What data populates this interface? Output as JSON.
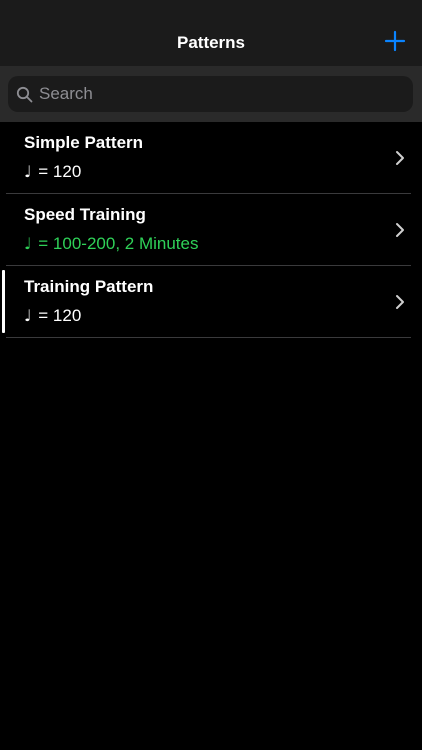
{
  "navbar": {
    "title": "Patterns",
    "add_label": "+"
  },
  "search": {
    "placeholder": "Search",
    "value": ""
  },
  "colors": {
    "accent": "#0a84ff",
    "tempo_active": "#2fd158"
  },
  "patterns": [
    {
      "name": "Simple Pattern",
      "note": "♩",
      "tempo": "= 120",
      "highlight": false,
      "selected": false
    },
    {
      "name": "Speed Training",
      "note": "♩",
      "tempo": "= 100-200, 2 Minutes",
      "highlight": true,
      "selected": false
    },
    {
      "name": "Training Pattern",
      "note": "♩",
      "tempo": "= 120",
      "highlight": false,
      "selected": true
    }
  ]
}
